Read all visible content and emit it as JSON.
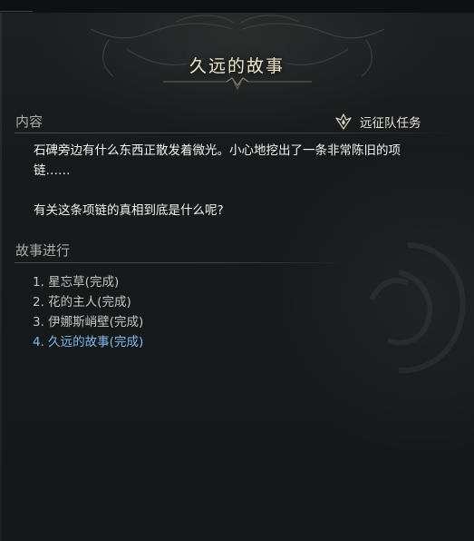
{
  "title": "久远的故事",
  "content_section": {
    "label": "内容",
    "badge_label": "远征队任务",
    "badge_icon": "expedition-emblem-icon",
    "paragraph_1_line_1": "石碑旁边有什么东西正散发着微光。小心地挖出了一条非常陈旧的项",
    "paragraph_1_line_2": "链……",
    "paragraph_2": "有关这条项链的真相到底是什么呢?"
  },
  "progress_section": {
    "label": "故事进行",
    "items": [
      {
        "text": "1. 星忘草(完成)",
        "current": false
      },
      {
        "text": "2. 花的主人(完成)",
        "current": false
      },
      {
        "text": "3. 伊娜斯峭壁(完成)",
        "current": false
      },
      {
        "text": "4. 久远的故事(完成)",
        "current": true
      }
    ]
  },
  "colors": {
    "title": "#f0e6cc",
    "current_item": "#7fb8ee",
    "text": "#f4f4f2",
    "label": "#a9adaa",
    "background": "#151a1b"
  }
}
